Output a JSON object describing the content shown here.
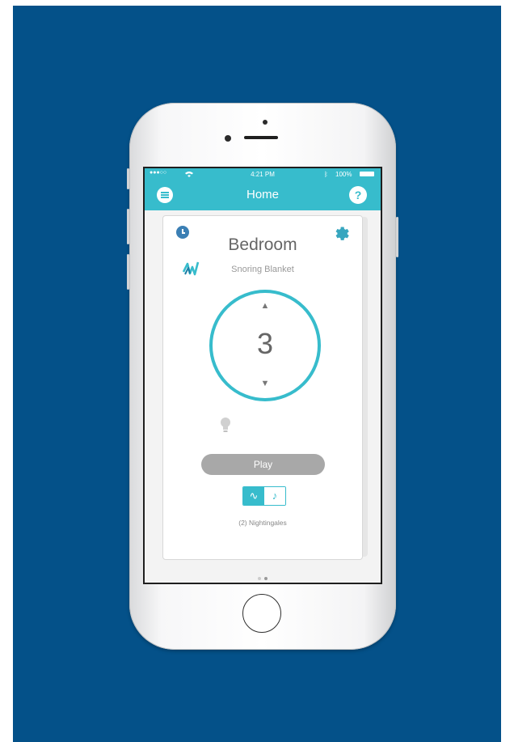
{
  "status_bar": {
    "carrier": "●●●○○",
    "time": "4:21 PM",
    "battery": "100%"
  },
  "nav": {
    "title": "Home",
    "help_label": "?"
  },
  "device": {
    "room": "Bedroom",
    "product": "Snoring Blanket",
    "level": "3",
    "up_arrow": "▲",
    "down_arrow": "▼"
  },
  "controls": {
    "play_label": "Play",
    "mode_wave": "∿",
    "mode_music": "♪",
    "sound_name": "(2) Nightingales"
  },
  "colors": {
    "accent": "#37bccc",
    "background": "#045189",
    "clock": "#3b7fb4"
  }
}
